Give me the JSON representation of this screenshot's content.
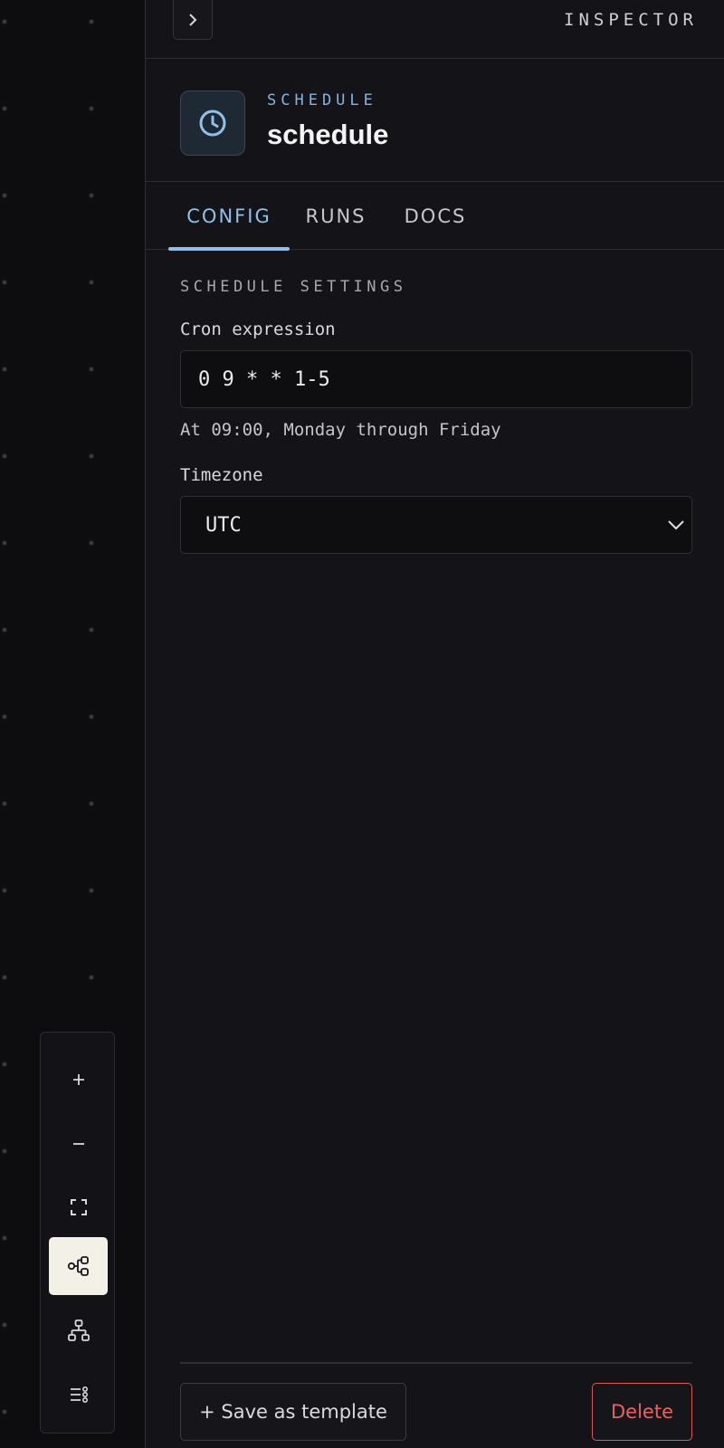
{
  "canvas": {
    "controls": [
      {
        "name": "zoom-in",
        "icon": "plus-icon",
        "label": "+"
      },
      {
        "name": "zoom-out",
        "icon": "minus-icon",
        "label": "−"
      },
      {
        "name": "fit-view",
        "icon": "fit-screen-icon"
      },
      {
        "name": "layout-horizontal",
        "icon": "horizontal-tree-icon",
        "active": true
      },
      {
        "name": "layout-vertical",
        "icon": "vertical-tree-icon"
      },
      {
        "name": "list-view",
        "icon": "list-icon"
      }
    ]
  },
  "inspector": {
    "title": "INSPECTOR",
    "collapse_icon": "chevron-right-icon",
    "node": {
      "kind": "SCHEDULE",
      "name": "schedule",
      "icon": "clock-icon"
    },
    "tabs": [
      {
        "label": "CONFIG",
        "active": true
      },
      {
        "label": "RUNS",
        "active": false
      },
      {
        "label": "DOCS",
        "active": false
      }
    ],
    "section_title": "SCHEDULE SETTINGS",
    "cron": {
      "label": "Cron expression",
      "value": "0 9 * * 1-5",
      "hint": "At 09:00, Monday through Friday"
    },
    "timezone": {
      "label": "Timezone",
      "value": "UTC",
      "icon": "chevron-down-icon"
    },
    "footer": {
      "save_template_label": "+ Save as template",
      "delete_label": "Delete"
    }
  },
  "colors": {
    "accent": "#8ec1ea",
    "danger": "#e56262",
    "panel_bg": "#141418",
    "canvas_bg": "#0d0d10"
  }
}
